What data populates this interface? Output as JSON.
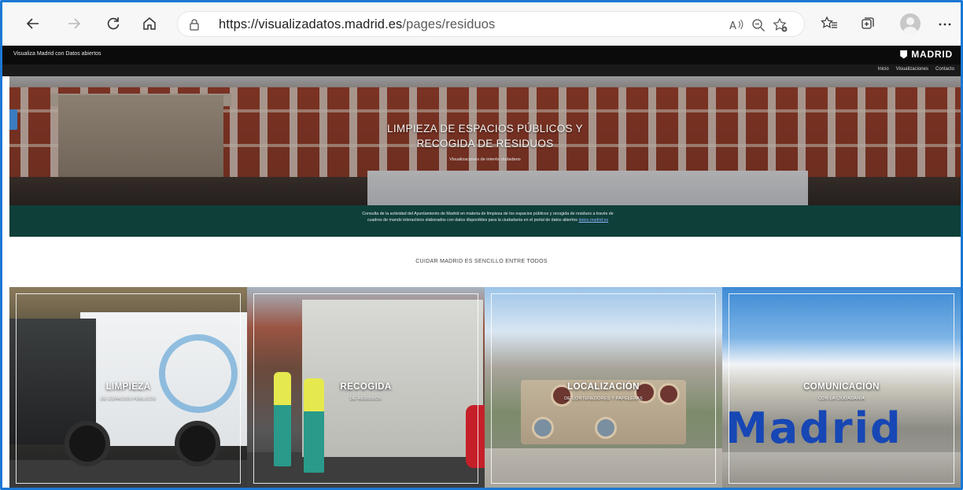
{
  "browser": {
    "url_domain": "https://visualizadatos.madrid.es",
    "url_path": "/pages/residuos",
    "icons": [
      "back-arrow-icon",
      "forward-arrow-icon",
      "refresh-icon",
      "home-icon",
      "lock-icon",
      "read-aloud-icon",
      "zoom-out-icon",
      "add-favorite-icon",
      "favorites-icon",
      "collections-icon",
      "profile-icon",
      "more-icon"
    ]
  },
  "site": {
    "brand": "Visualiza Madrid con Datos abiertos",
    "logo": "MADRID",
    "nav": [
      "Inicio",
      "Visualizaciones",
      "Contacto"
    ]
  },
  "hero": {
    "title_line1": "LIMPIEZA DE ESPACIOS PÚBLICOS Y",
    "title_line2": "RECOGIDA DE RESIDUOS",
    "subtitle": "Visualizaciones de interés ciudadano"
  },
  "intro": {
    "text": "Consulta de la actividad del Ayuntamiento de Madrid en materia de limpieza de los espacios públicos y recogida de residuos a través de cuadros de mando interactivos elaborados con datos disponibles para la ciudadanía en el portal de datos abiertos",
    "link": "datos.madrid.es"
  },
  "motto": "CUIDAR MADRID ES SENCILLO ENTRE TODOS",
  "cards": [
    {
      "title": "LIMPIEZA",
      "caption": "DE ESPACIOS PÚBLICOS"
    },
    {
      "title": "RECOGIDA",
      "caption": "DE RESIDUOS"
    },
    {
      "title": "LOCALIZACIÓN",
      "caption": "DE CONTENEDORES Y PAPELERAS"
    },
    {
      "title": "COMUNICACIÓN",
      "caption": "CON LA CIUDADANÍA",
      "sign": "Madrid"
    }
  ],
  "colors": {
    "window_border": "#1c78d4",
    "intro_band": "#0f3f39",
    "header_bar": "#0b0b0b"
  }
}
